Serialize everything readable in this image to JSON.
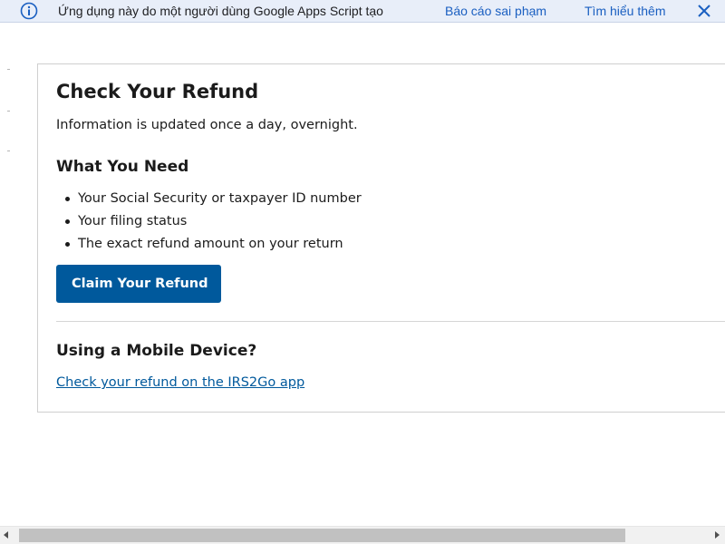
{
  "notification_bar": {
    "message": "Ứng dụng này do một người dùng Google Apps Script tạo",
    "report_link": "Báo cáo sai phạm",
    "learn_more_link": "Tìm hiểu thêm",
    "info_icon": "info-circle-icon",
    "close_icon": "close-x-icon",
    "background_color": "#e8eef9",
    "link_color": "#1a5fc1"
  },
  "card": {
    "title": "Check Your Refund",
    "subtitle": "Information is updated once a day, overnight.",
    "section_heading": "What You Need",
    "requirements": [
      "Your Social Security or taxpayer ID number",
      "Your filing status",
      "The exact refund amount on your return"
    ],
    "claim_button_label": "Claim Your Refund",
    "mobile_heading": "Using a Mobile Device?",
    "mobile_link": "Check your refund on the IRS2Go app",
    "accent_color": "#00599c"
  },
  "scrollbar": {
    "orientation": "horizontal"
  }
}
